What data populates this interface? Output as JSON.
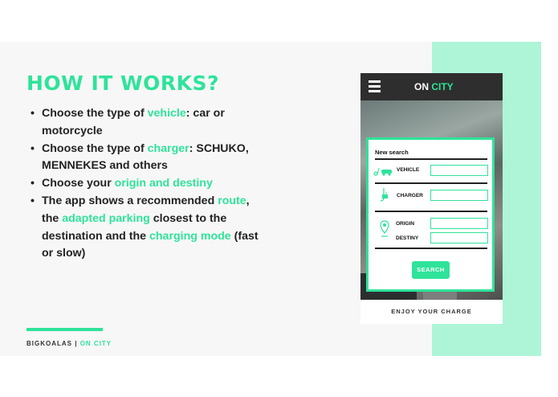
{
  "slide": {
    "title": "HOW IT WORKS?",
    "bullets": [
      {
        "parts": [
          {
            "t": "Choose the type of ",
            "h": false
          },
          {
            "t": "vehicle",
            "h": true
          },
          {
            "t": ": car or motorcycle",
            "h": false
          }
        ]
      },
      {
        "parts": [
          {
            "t": "Choose the type of ",
            "h": false
          },
          {
            "t": "charger",
            "h": true
          },
          {
            "t": ": SCHUKO, MENNEKES and others",
            "h": false
          }
        ]
      },
      {
        "parts": [
          {
            "t": "Choose your ",
            "h": false
          },
          {
            "t": "origin and destiny",
            "h": true
          }
        ]
      },
      {
        "parts": [
          {
            "t": "The app shows a recommended ",
            "h": false
          },
          {
            "t": "route",
            "h": true
          },
          {
            "t": ", the ",
            "h": false
          },
          {
            "t": "adapted parking",
            "h": true
          },
          {
            "t": " closest to the destination and the ",
            "h": false
          },
          {
            "t": "charging mode",
            "h": true
          },
          {
            "t": " (fast or slow)",
            "h": false
          }
        ]
      }
    ],
    "footer_brand": "BIGKOALAS",
    "footer_sep": " | ",
    "footer_product": "ON CITY"
  },
  "app": {
    "title_a": "ON ",
    "title_b": "CITY",
    "card_title": "New search",
    "vehicle_label": "VEHICLE",
    "charger_label": "CHARGER",
    "origin_label": "ORIGIN",
    "destiny_label": "DESTINY",
    "vehicle_value": "",
    "charger_value": "",
    "origin_value": "",
    "destiny_value": "",
    "search_label": "SEARCH",
    "bottom_text": "ENJOY YOUR CHARGE"
  },
  "icons": {
    "menu": "hamburger-icon",
    "vehicle": "car-motorcycle-icon",
    "charger": "plug-icon",
    "location": "location-pin-icon"
  },
  "colors": {
    "accent": "#2fe39a",
    "panel": "#aef5d8",
    "app_bar": "#2e2e2e"
  }
}
